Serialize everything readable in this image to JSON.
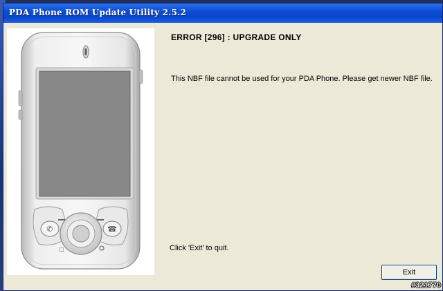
{
  "window": {
    "title": "PDA Phone ROM Update Utility 2.5.2"
  },
  "dialog": {
    "error_title": "ERROR [296] :  UPGRADE ONLY",
    "message": "This NBF file cannot be used for your PDA Phone. Please get newer NBF file.",
    "quit_hint": "Click 'Exit' to quit.",
    "exit_label": "Exit"
  },
  "watermark": "#321770",
  "colors": {
    "titlebar": "#0e4fd6",
    "window_bg": "#ece9d8",
    "screen": "#888888"
  },
  "icons": [
    "pda-phone-illustration"
  ]
}
